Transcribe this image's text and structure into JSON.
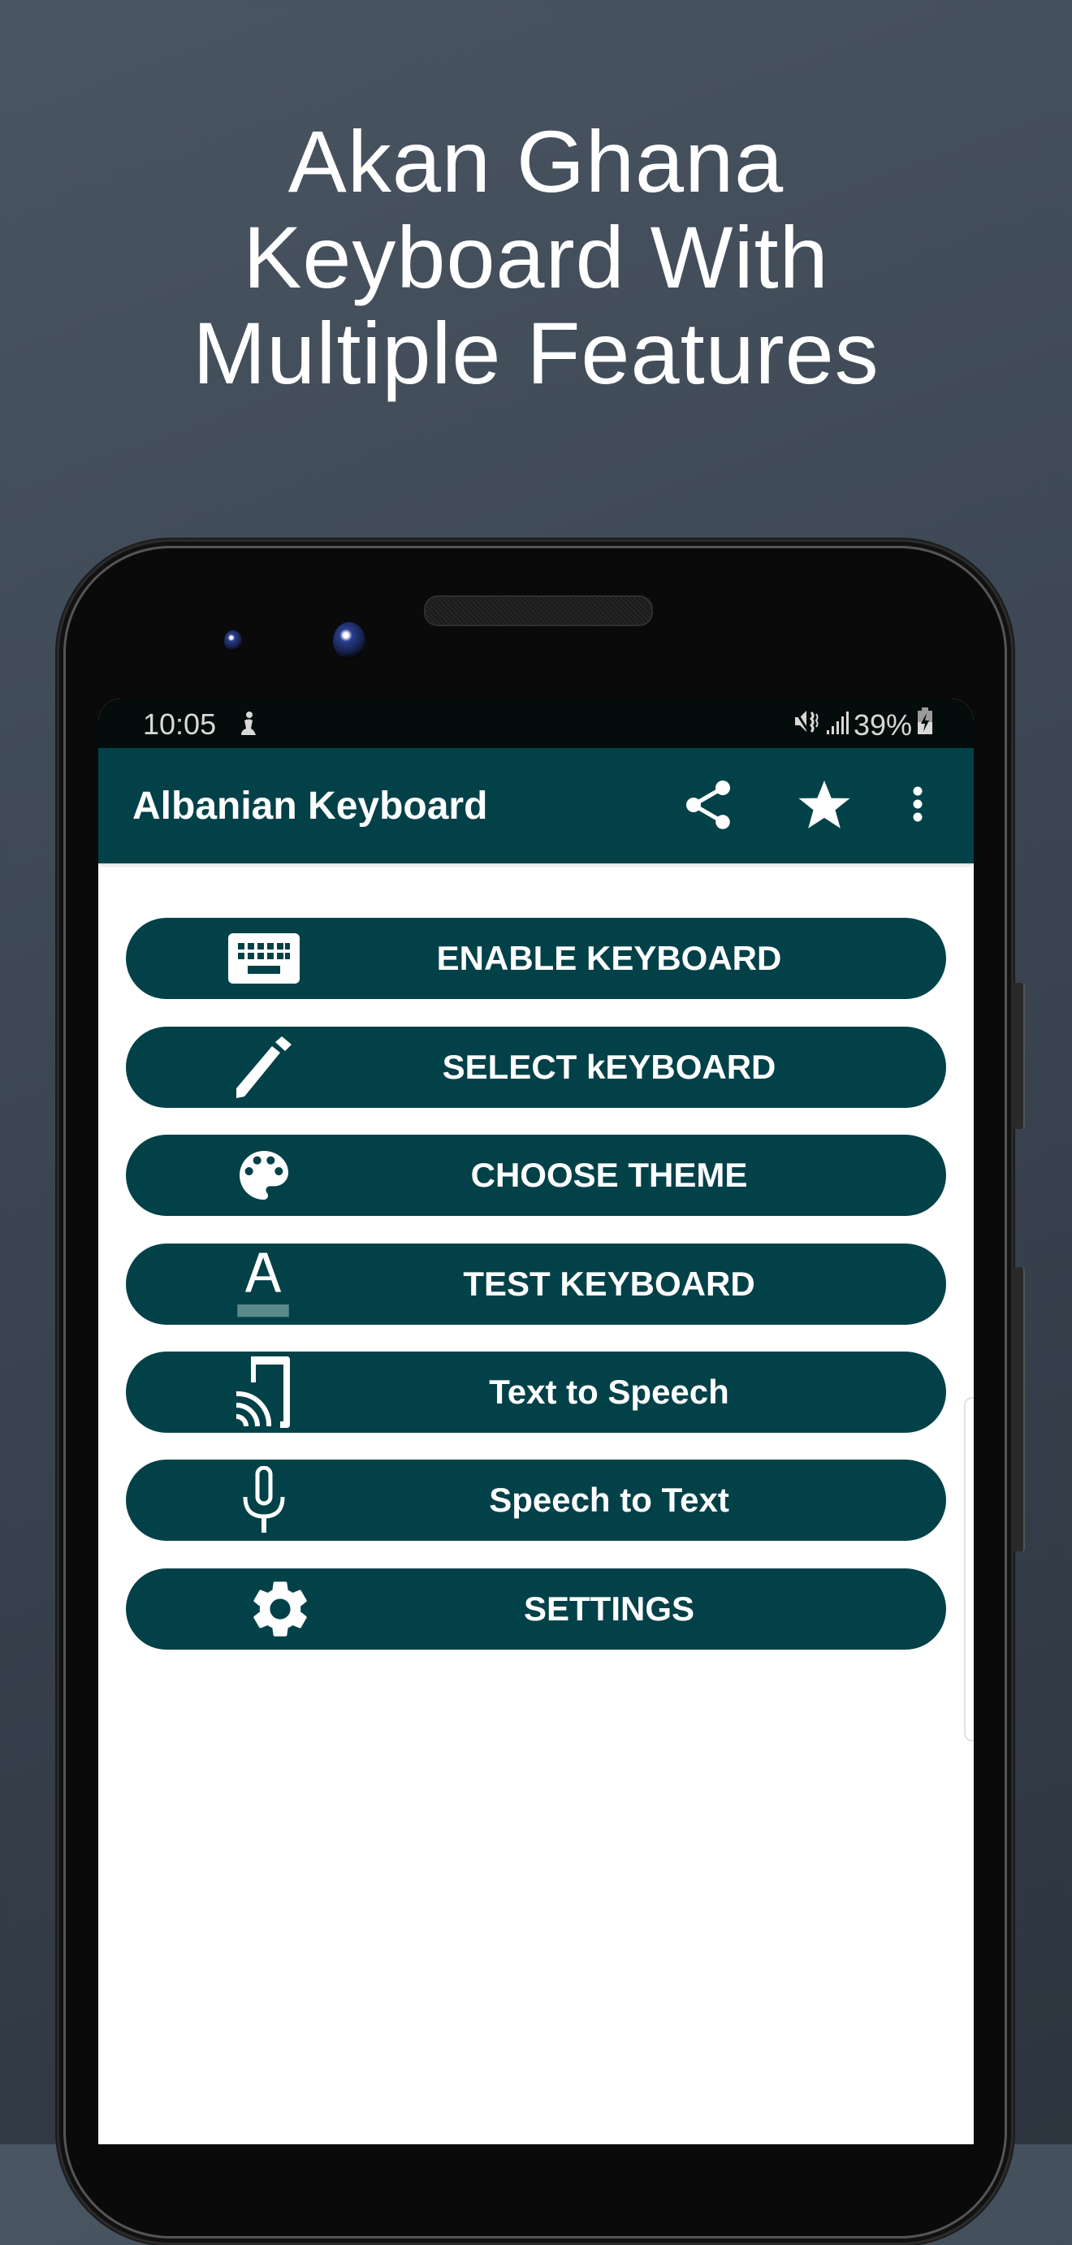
{
  "headline": {
    "lines": [
      "Akan Ghana",
      "Keyboard With",
      "Multiple Features"
    ]
  },
  "status_bar": {
    "time": "10:05",
    "left_icons": [
      "accessibility-icon"
    ],
    "right_icons": [
      "vibrate-mute-icon",
      "signal-icon",
      "battery-charging-icon"
    ],
    "battery": "39%"
  },
  "toolbar": {
    "title": "Albanian Keyboard",
    "actions": [
      {
        "name": "share",
        "icon": "share-icon"
      },
      {
        "name": "rate",
        "icon": "star-icon"
      },
      {
        "name": "more",
        "icon": "more-vert-icon"
      }
    ]
  },
  "menu": {
    "buttons": [
      {
        "label": "ENABLE KEYBOARD",
        "icon": "keyboard-icon"
      },
      {
        "label": "SELECT kEYBOARD",
        "icon": "pencil-icon"
      },
      {
        "label": "CHOOSE THEME",
        "icon": "palette-icon"
      },
      {
        "label": "TEST KEYBOARD",
        "icon": "text-format-icon"
      },
      {
        "label": "Text to Speech",
        "icon": "cast-icon"
      },
      {
        "label": "Speech to Text",
        "icon": "microphone-icon"
      },
      {
        "label": "SETTINGS",
        "icon": "gear-icon"
      }
    ]
  },
  "colors": {
    "primary": "#034149",
    "status_bar": "#050c0c",
    "background_top": "#4a5562",
    "background_bottom": "#2c343e",
    "text_on_primary": "#ffffff"
  }
}
